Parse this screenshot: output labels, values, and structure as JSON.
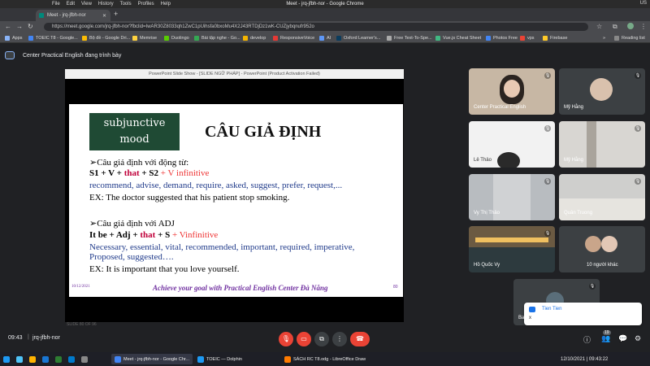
{
  "os": {
    "menus": [
      "File",
      "Edit",
      "View",
      "History",
      "Tools",
      "Profiles",
      "Help"
    ],
    "window_title": "Meet - jrq-jfbh-nor - Google Chrome",
    "keyboard": "US"
  },
  "browser": {
    "tab_title": "Meet - jrq-jfbh-nor",
    "url": "https://meet.google.com/jrq-jfbh-nor?fbclid=IwAR30Z8033qh1ZwC1pUihsfa0bxoMu4X2J43RTDjDz1wK-CUZjybqnufr952o",
    "bookmarks": [
      {
        "label": "Apps",
        "color": "#8ab4f8"
      },
      {
        "label": "TOEIC T8 - Google...",
        "color": "#4285f4"
      },
      {
        "label": "Bộ đề - Google Dri...",
        "color": "#fbbc04"
      },
      {
        "label": "Memrise",
        "color": "#ffd23f"
      },
      {
        "label": "Duolingo",
        "color": "#58cc02"
      },
      {
        "label": "Bài tập nghe - Go...",
        "color": "#34a853"
      },
      {
        "label": "develop",
        "color": "#f4b400"
      },
      {
        "label": "ResponsiveVoice",
        "color": "#e53935"
      },
      {
        "label": "AI",
        "color": "#5e97f6"
      },
      {
        "label": "Oxford Learner's...",
        "color": "#0b3c5d"
      },
      {
        "label": "Free Text-To-Spe...",
        "color": "#aaaaaa"
      },
      {
        "label": "Vue.js Cheat Sheet",
        "color": "#41b883"
      },
      {
        "label": "Photos Free",
        "color": "#4285f4"
      },
      {
        "label": "vps",
        "color": "#ea4335"
      },
      {
        "label": "Firebase",
        "color": "#ffca28"
      }
    ],
    "reading_list": "Reading list"
  },
  "meet": {
    "presenter_banner": "Center Practical English đang trình bày",
    "clock": "09:43",
    "separator": "|",
    "meeting_code": "jrq-jfbh-nor",
    "participants_count": "19"
  },
  "slide": {
    "window_title": "PowerPoint Slide Show - [SLIDE NGỮ PHÁP] - PowerPoint (Product Activation Failed)",
    "mood_line1": "subjunctive",
    "mood_line2": "mood",
    "heading": "CÂU GIẢ ĐỊNH",
    "verb_intro": "➢Câu giả định với động từ:",
    "verb_formula": {
      "p1": "S1 + V + ",
      "p2": "that",
      "p3": " + S2 ",
      "p4": "+ V infinitive"
    },
    "verb_list": "recommend, advise, demand, require, asked, suggest, prefer, request,...",
    "verb_example": "EX: The doctor suggested that his patient stop smoking.",
    "adj_intro": "➢Câu giả định với ADJ",
    "adj_formula": {
      "p1": "It be + Adj + ",
      "p2": "that",
      "p3": " + S ",
      "p4": "+ Vinfinitive"
    },
    "adj_list1": "Necessary, essential, vital, recommended, important, required, imperative,",
    "adj_list2": "Proposed, suggested….",
    "adj_example": "EX: It is important that you love yourself.",
    "footer_date": "10/12/2021",
    "footer_text": "Achieve your goal with Practical English Center Đà Nẵng",
    "footer_page": "80",
    "slide_counter": "SLIDE 80 OF 96"
  },
  "participants": [
    {
      "name": "Center Practical English"
    },
    {
      "name": "Mỹ Hằng"
    },
    {
      "name": "Lê Thảo"
    },
    {
      "name": "Mỹ Hằng"
    },
    {
      "name": "Vy Thị Thảo"
    },
    {
      "name": "Quân Truong"
    },
    {
      "name": "Hồ Quốc Vy"
    },
    {
      "name": "10 người khác"
    },
    {
      "name": "Ba..."
    }
  ],
  "chat_toast": {
    "sender": "Tien Tien",
    "message": "x"
  },
  "taskbar": {
    "apps": [
      {
        "label": "Meet - jrq-jfbh-nor - Google Chr...",
        "color": "#4285f4"
      },
      {
        "label": "TOEIC — Dolphin",
        "color": "#1d99f3"
      },
      {
        "label": "SÁCH RC T8.odg - LibreOffice Draw",
        "color": "#ff7b00"
      }
    ],
    "datetime": "12/10/2021 | 09:43:22"
  }
}
